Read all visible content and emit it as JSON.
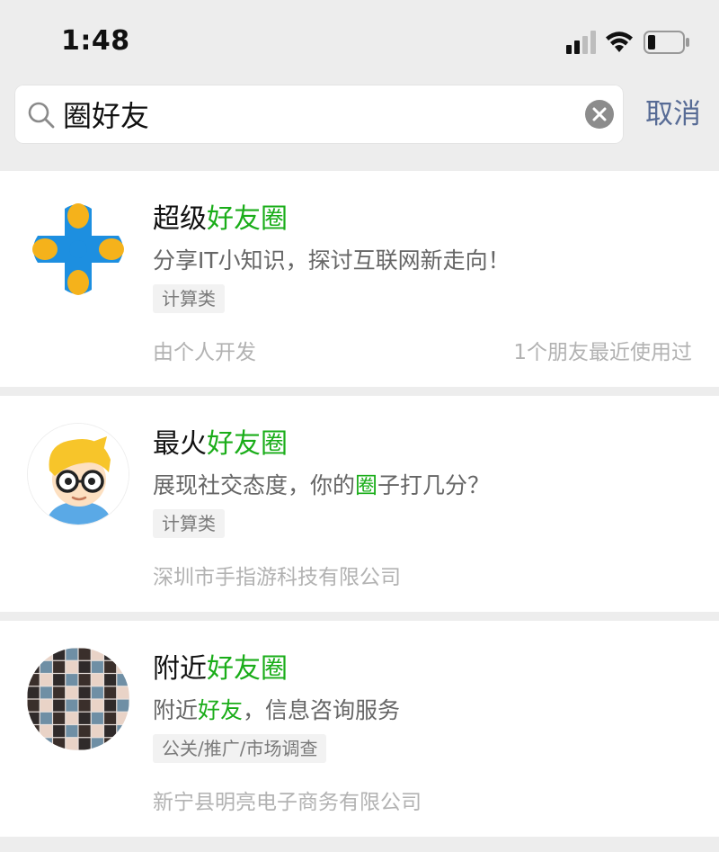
{
  "status_bar": {
    "time": "1:48",
    "icons": [
      "cellular-signal-icon",
      "wifi-icon",
      "battery-icon"
    ]
  },
  "search": {
    "value": "圈好友",
    "cancel_label": "取消",
    "icons": [
      "search-icon",
      "clear-icon"
    ]
  },
  "colors": {
    "highlight": "#1aad19",
    "cancel": "#576b95",
    "muted": "#b2b2b2"
  },
  "results": [
    {
      "title_prefix": "超级",
      "title_highlight": "好友圈",
      "desc_parts": [
        "分享IT小知识，探讨互联网新走向！"
      ],
      "desc_highlight": "",
      "desc_suffix": "",
      "category": "计算类",
      "developer": "由个人开发",
      "friends_used": "1个朋友最近使用过",
      "avatar_icon": "puzzle-cross-icon"
    },
    {
      "title_prefix": "最火",
      "title_highlight": "好友圈",
      "desc_parts": [
        "展现社交态度，你的"
      ],
      "desc_highlight": "圈",
      "desc_suffix": "子打几分？",
      "category": "计算类",
      "developer": "深圳市手指游科技有限公司",
      "friends_used": "",
      "avatar_icon": "cartoon-boy-glasses-icon"
    },
    {
      "title_prefix": "附近",
      "title_highlight": "好友圈",
      "desc_parts": [
        "附近"
      ],
      "desc_highlight": "好友",
      "desc_suffix": "，信息咨询服务",
      "category": "公关/推广/市场调查",
      "developer": "新宁县明亮电子商务有限公司",
      "friends_used": "",
      "avatar_icon": "photo-collage-icon"
    }
  ]
}
